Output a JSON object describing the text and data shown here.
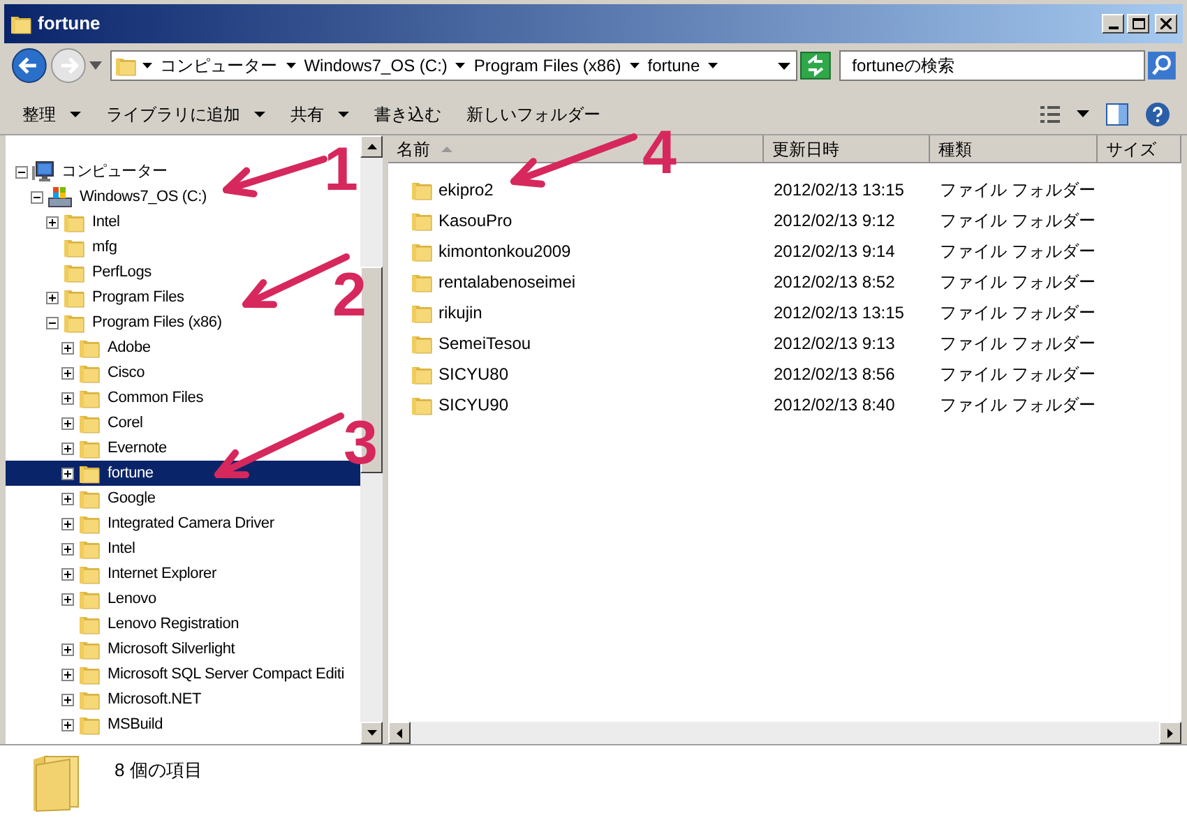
{
  "window": {
    "title": "fortune"
  },
  "address_bar": {
    "breadcrumbs": [
      "コンピューター",
      "Windows7_OS (C:)",
      "Program Files (x86)",
      "fortune"
    ]
  },
  "search": {
    "placeholder": "fortuneの検索"
  },
  "toolbar": {
    "items": [
      {
        "label": "整理",
        "dropdown": true
      },
      {
        "label": "ライブラリに追加",
        "dropdown": true
      },
      {
        "label": "共有",
        "dropdown": true
      },
      {
        "label": "書き込む",
        "dropdown": false
      },
      {
        "label": "新しいフォルダー",
        "dropdown": false
      }
    ]
  },
  "tree": [
    {
      "label": "コンピューター",
      "kind": "computer",
      "expanded": true,
      "selected": false,
      "children": [
        {
          "label": "Windows7_OS (C:)",
          "kind": "drive",
          "expanded": true,
          "selected": false,
          "children": [
            {
              "label": "Intel",
              "kind": "folder",
              "expanded": false,
              "selected": false
            },
            {
              "label": "mfg",
              "kind": "folder",
              "selected": false
            },
            {
              "label": "PerfLogs",
              "kind": "folder",
              "selected": false
            },
            {
              "label": "Program Files",
              "kind": "folder",
              "expanded": false,
              "selected": false
            },
            {
              "label": "Program Files (x86)",
              "kind": "folder",
              "expanded": true,
              "selected": false,
              "children": [
                {
                  "label": "Adobe",
                  "kind": "folder",
                  "expanded": false,
                  "selected": false
                },
                {
                  "label": "Cisco",
                  "kind": "folder",
                  "expanded": false,
                  "selected": false
                },
                {
                  "label": "Common Files",
                  "kind": "folder",
                  "expanded": false,
                  "selected": false
                },
                {
                  "label": "Corel",
                  "kind": "folder",
                  "expanded": false,
                  "selected": false
                },
                {
                  "label": "Evernote",
                  "kind": "folder",
                  "expanded": false,
                  "selected": false
                },
                {
                  "label": "fortune",
                  "kind": "folder",
                  "expanded": false,
                  "selected": true
                },
                {
                  "label": "Google",
                  "kind": "folder",
                  "expanded": false,
                  "selected": false
                },
                {
                  "label": "Integrated Camera Driver",
                  "kind": "folder",
                  "expanded": false,
                  "selected": false
                },
                {
                  "label": "Intel",
                  "kind": "folder",
                  "expanded": false,
                  "selected": false
                },
                {
                  "label": "Internet Explorer",
                  "kind": "folder",
                  "expanded": false,
                  "selected": false
                },
                {
                  "label": "Lenovo",
                  "kind": "folder",
                  "expanded": false,
                  "selected": false
                },
                {
                  "label": "Lenovo Registration",
                  "kind": "folder",
                  "selected": false
                },
                {
                  "label": "Microsoft Silverlight",
                  "kind": "folder",
                  "expanded": false,
                  "selected": false
                },
                {
                  "label": "Microsoft SQL Server Compact Editi",
                  "kind": "folder",
                  "expanded": false,
                  "selected": false
                },
                {
                  "label": "Microsoft.NET",
                  "kind": "folder",
                  "expanded": false,
                  "selected": false
                },
                {
                  "label": "MSBuild",
                  "kind": "folder",
                  "expanded": false,
                  "selected": false
                }
              ]
            }
          ]
        }
      ]
    }
  ],
  "table": {
    "columns": [
      "名前",
      "更新日時",
      "種類",
      "サイズ"
    ],
    "rows": [
      {
        "name": "ekipro2",
        "modified": "2012/02/13 13:15",
        "type": "ファイル フォルダー"
      },
      {
        "name": "KasouPro",
        "modified": "2012/02/13 9:12",
        "type": "ファイル フォルダー"
      },
      {
        "name": "kimontonkou2009",
        "modified": "2012/02/13 9:14",
        "type": "ファイル フォルダー"
      },
      {
        "name": "rentalabenoseimei",
        "modified": "2012/02/13 8:52",
        "type": "ファイル フォルダー"
      },
      {
        "name": "rikujin",
        "modified": "2012/02/13 13:15",
        "type": "ファイル フォルダー"
      },
      {
        "name": "SemeiTesou",
        "modified": "2012/02/13 9:13",
        "type": "ファイル フォルダー"
      },
      {
        "name": "SICYU80",
        "modified": "2012/02/13 8:56",
        "type": "ファイル フォルダー"
      },
      {
        "name": "SICYU90",
        "modified": "2012/02/13 8:40",
        "type": "ファイル フォルダー"
      }
    ]
  },
  "status_bar": {
    "text": "8 個の項目"
  },
  "annotations": [
    {
      "label": "1"
    },
    {
      "label": "2"
    },
    {
      "label": "3"
    },
    {
      "label": "4"
    }
  ]
}
